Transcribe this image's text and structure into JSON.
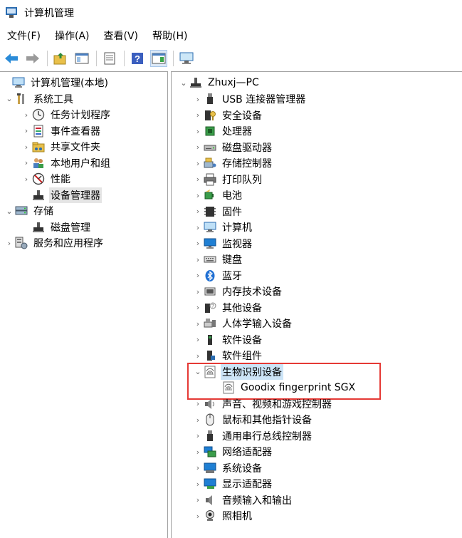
{
  "window": {
    "title": "计算机管理"
  },
  "menu": [
    "文件(F)",
    "操作(A)",
    "查看(V)",
    "帮助(H)"
  ],
  "toolbar": [
    "back-icon",
    "forward-icon",
    "up-folder-icon",
    "show-hide-tree-icon",
    "properties-icon",
    "help-icon",
    "show-action-pane-icon",
    "monitor-icon"
  ],
  "left_tree": [
    {
      "label": "计算机管理(本地)",
      "icon": "computer-management-icon",
      "chev": ""
    },
    {
      "label": "系统工具",
      "icon": "tools-icon",
      "chev": "⌄"
    },
    {
      "label": "任务计划程序",
      "icon": "clock-icon",
      "chev": "›"
    },
    {
      "label": "事件查看器",
      "icon": "event-viewer-icon",
      "chev": "›"
    },
    {
      "label": "共享文件夹",
      "icon": "shared-folder-icon",
      "chev": "›"
    },
    {
      "label": "本地用户和组",
      "icon": "users-icon",
      "chev": "›"
    },
    {
      "label": "性能",
      "icon": "performance-icon",
      "chev": "›"
    },
    {
      "label": "设备管理器",
      "icon": "device-manager-icon",
      "chev": "",
      "selected": true
    },
    {
      "label": "存储",
      "icon": "storage-icon",
      "chev": "⌄"
    },
    {
      "label": "磁盘管理",
      "icon": "disk-management-icon",
      "chev": ""
    },
    {
      "label": "服务和应用程序",
      "icon": "services-icon",
      "chev": "›"
    }
  ],
  "right_tree": {
    "root": {
      "label": "Zhuxj—PC",
      "icon": "pc-icon",
      "chev": "⌄"
    },
    "categories": [
      {
        "label": "USB 连接器管理器",
        "icon": "usb-icon"
      },
      {
        "label": "安全设备",
        "icon": "security-device-icon"
      },
      {
        "label": "处理器",
        "icon": "processor-icon"
      },
      {
        "label": "磁盘驱动器",
        "icon": "disk-drive-icon"
      },
      {
        "label": "存储控制器",
        "icon": "storage-controller-icon"
      },
      {
        "label": "打印队列",
        "icon": "printer-icon"
      },
      {
        "label": "电池",
        "icon": "battery-icon"
      },
      {
        "label": "固件",
        "icon": "firmware-icon"
      },
      {
        "label": "计算机",
        "icon": "computer-icon"
      },
      {
        "label": "监视器",
        "icon": "monitor-icon"
      },
      {
        "label": "键盘",
        "icon": "keyboard-icon"
      },
      {
        "label": "蓝牙",
        "icon": "bluetooth-icon"
      },
      {
        "label": "内存技术设备",
        "icon": "memory-device-icon"
      },
      {
        "label": "其他设备",
        "icon": "other-device-icon"
      },
      {
        "label": "人体学输入设备",
        "icon": "hid-icon"
      },
      {
        "label": "软件设备",
        "icon": "software-device-icon"
      },
      {
        "label": "软件组件",
        "icon": "software-component-icon"
      },
      {
        "label": "生物识别设备",
        "icon": "fingerprint-icon",
        "expanded": true,
        "highlighted": true
      },
      {
        "label": "Goodix fingerprint SGX",
        "icon": "fingerprint-icon",
        "child": true
      },
      {
        "label": "声音、视频和游戏控制器",
        "icon": "speaker-icon"
      },
      {
        "label": "鼠标和其他指针设备",
        "icon": "mouse-icon"
      },
      {
        "label": "通用串行总线控制器",
        "icon": "usb-controller-icon"
      },
      {
        "label": "网络适配器",
        "icon": "network-adapter-icon"
      },
      {
        "label": "系统设备",
        "icon": "system-device-icon"
      },
      {
        "label": "显示适配器",
        "icon": "display-adapter-icon"
      },
      {
        "label": "音频输入和输出",
        "icon": "audio-io-icon"
      },
      {
        "label": "照相机",
        "icon": "camera-icon"
      }
    ]
  }
}
